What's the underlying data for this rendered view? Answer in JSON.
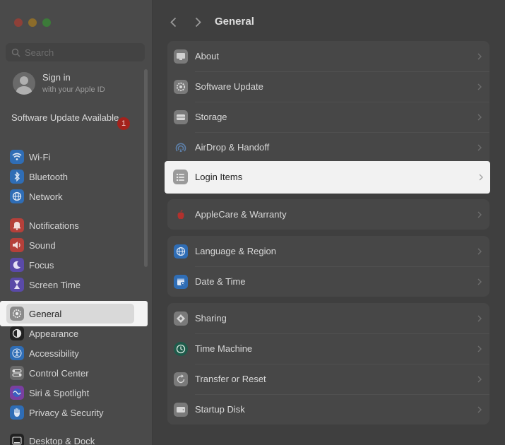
{
  "window": {
    "controls": [
      "close",
      "minimize",
      "maximize"
    ]
  },
  "sidebar": {
    "search": {
      "placeholder": "Search",
      "value": ""
    },
    "account": {
      "title": "Sign in",
      "subtitle": "with your Apple ID"
    },
    "software_update": {
      "label": "Software Update Available",
      "badge": "1"
    },
    "items": [
      {
        "label": "Wi-Fi",
        "icon": "wifi-icon",
        "color": "#2f6db5"
      },
      {
        "label": "Bluetooth",
        "icon": "bluetooth-icon",
        "color": "#2f6db5"
      },
      {
        "label": "Network",
        "icon": "network-icon",
        "color": "#2f6db5"
      },
      {
        "label": "Notifications",
        "icon": "bell-icon",
        "color": "#b5403a"
      },
      {
        "label": "Sound",
        "icon": "speaker-icon",
        "color": "#b5403a"
      },
      {
        "label": "Focus",
        "icon": "moon-icon",
        "color": "#5a4aa8"
      },
      {
        "label": "Screen Time",
        "icon": "hourglass-icon",
        "color": "#5a4aa8"
      },
      {
        "label": "General",
        "icon": "gear-icon",
        "color": "#8a8a8a"
      },
      {
        "label": "Appearance",
        "icon": "appearance-icon",
        "color": "#222222"
      },
      {
        "label": "Accessibility",
        "icon": "accessibility-icon",
        "color": "#2f6db5"
      },
      {
        "label": "Control Center",
        "icon": "control-center-icon",
        "color": "#6a6a6a"
      },
      {
        "label": "Siri & Spotlight",
        "icon": "siri-icon",
        "color": "#7a3fa0"
      },
      {
        "label": "Privacy & Security",
        "icon": "hand-icon",
        "color": "#2f6db5"
      },
      {
        "label": "Desktop & Dock",
        "icon": "dock-icon",
        "color": "#222222"
      }
    ]
  },
  "main": {
    "title": "General",
    "groups": [
      {
        "rows": [
          {
            "label": "About",
            "icon": "about-icon"
          },
          {
            "label": "Software Update",
            "icon": "software-update-icon"
          },
          {
            "label": "Storage",
            "icon": "storage-icon"
          },
          {
            "label": "AirDrop & Handoff",
            "icon": "airdrop-icon"
          },
          {
            "label": "Login Items",
            "icon": "login-items-icon"
          }
        ]
      },
      {
        "rows": [
          {
            "label": "AppleCare & Warranty",
            "icon": "apple-icon"
          }
        ]
      },
      {
        "rows": [
          {
            "label": "Language & Region",
            "icon": "globe-icon"
          },
          {
            "label": "Date & Time",
            "icon": "calendar-icon"
          }
        ]
      },
      {
        "rows": [
          {
            "label": "Sharing",
            "icon": "sharing-icon"
          },
          {
            "label": "Time Machine",
            "icon": "time-machine-icon"
          },
          {
            "label": "Transfer or Reset",
            "icon": "reset-icon"
          },
          {
            "label": "Startup Disk",
            "icon": "disk-icon"
          }
        ]
      }
    ]
  }
}
